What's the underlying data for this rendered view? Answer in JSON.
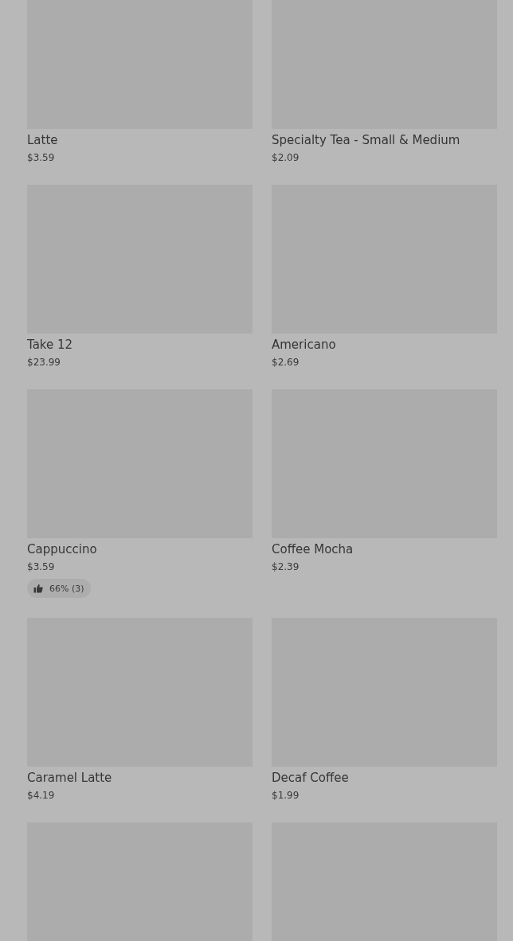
{
  "items": [
    {
      "kind": "placeholder",
      "name": "Latte",
      "price": "$3.59"
    },
    {
      "kind": "placeholder",
      "name": "Specialty Tea - Small & Medium",
      "price": "$2.09"
    },
    {
      "kind": "placeholder",
      "name": "Take 12",
      "price": "$23.99"
    },
    {
      "kind": "placeholder",
      "name": "Americano",
      "price": "$2.69"
    },
    {
      "kind": "placeholder",
      "name": "Cappuccino",
      "price": "$3.59",
      "rating": "66% (3)"
    },
    {
      "kind": "placeholder",
      "name": "Coffee Mocha",
      "price": "$2.39"
    },
    {
      "kind": "placeholder",
      "name": "Caramel Latte",
      "price": "$4.19"
    },
    {
      "kind": "placeholder",
      "name": "Decaf Coffee",
      "price": "$1.99"
    },
    {
      "kind": "placeholder"
    },
    {
      "kind": "placeholder"
    }
  ]
}
